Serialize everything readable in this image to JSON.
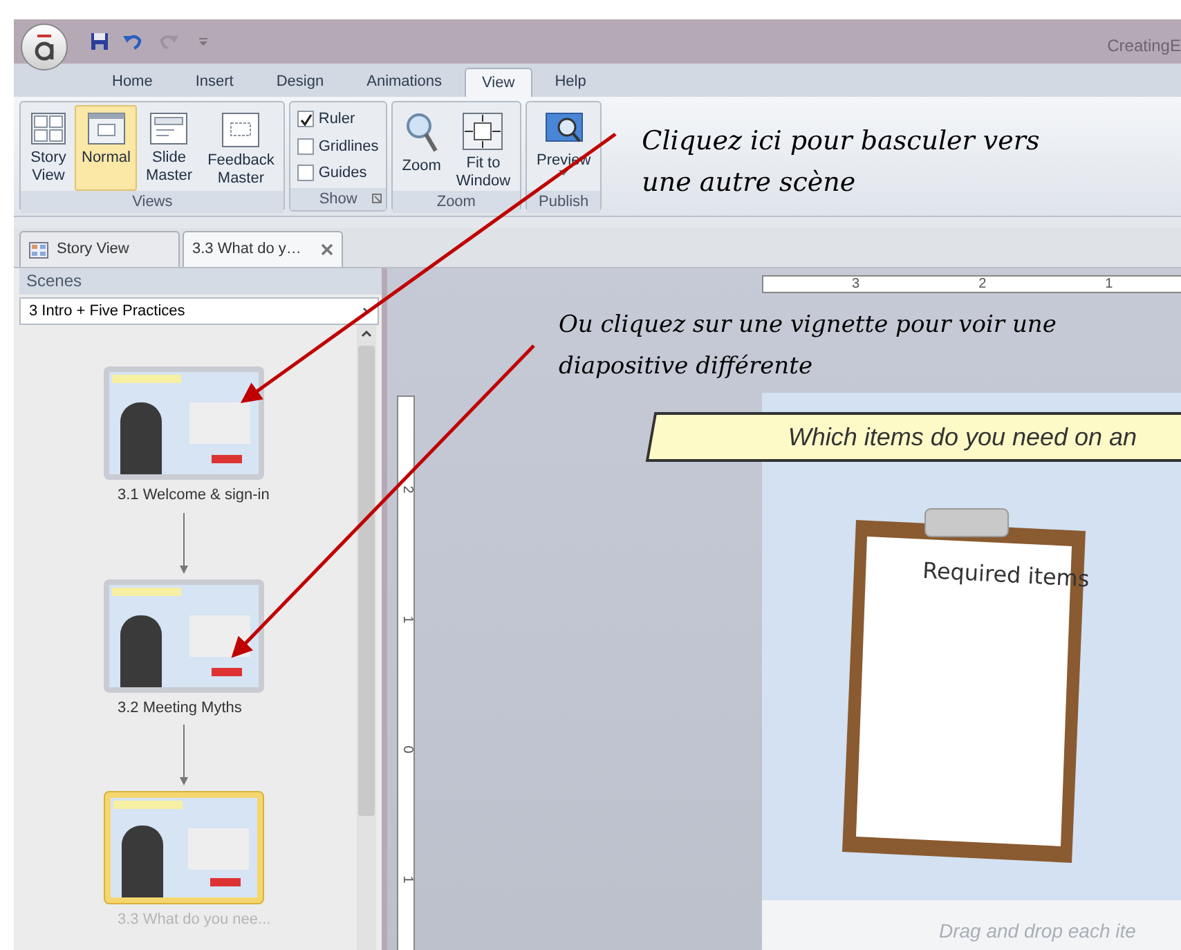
{
  "window": {
    "title": "CreatingE"
  },
  "ribbon_tabs": [
    {
      "label": "Home",
      "selected": false
    },
    {
      "label": "Insert",
      "selected": false
    },
    {
      "label": "Design",
      "selected": false
    },
    {
      "label": "Animations",
      "selected": false
    },
    {
      "label": "View",
      "selected": true
    },
    {
      "label": "Help",
      "selected": false
    }
  ],
  "ribbon_groups": [
    {
      "label": "Views",
      "kind": "buttons",
      "items": [
        {
          "label": "Story View",
          "selected": false
        },
        {
          "label": "Normal",
          "selected": true
        },
        {
          "label": "Slide Master",
          "selected": false
        },
        {
          "label": "Feedback Master",
          "selected": false
        }
      ]
    },
    {
      "label": "Show",
      "kind": "checkboxes",
      "launcher": true,
      "items": [
        {
          "label": "Ruler",
          "checked": true
        },
        {
          "label": "Gridlines",
          "checked": false
        },
        {
          "label": "Guides",
          "checked": false
        }
      ]
    },
    {
      "label": "Zoom",
      "kind": "buttons",
      "items": [
        {
          "label": "Zoom",
          "selected": false
        },
        {
          "label": "Fit to Window",
          "selected": false
        }
      ]
    },
    {
      "label": "Publish",
      "kind": "buttons",
      "items": [
        {
          "label": "Preview",
          "selected": false,
          "dropdown": true
        }
      ]
    }
  ],
  "annotations": [
    {
      "text": "Cliquez ici pour basculer vers une autre scène"
    },
    {
      "text": "Ou cliquez sur une vignette pour voir une diapositive différente"
    }
  ],
  "document_tabs": [
    {
      "label": "Story View",
      "selected": false,
      "closable": false
    },
    {
      "label": "3.3 What do y…",
      "selected": true,
      "closable": true
    }
  ],
  "scenes_panel": {
    "title": "Scenes",
    "dropdown": "3 Intro + Five Practices",
    "slides": [
      {
        "label": "3.1 Welcome & sign-in",
        "selected": false
      },
      {
        "label": "3.2 Meeting Myths",
        "selected": false
      },
      {
        "label": "3.3 What do you nee...",
        "selected": true
      }
    ]
  },
  "ruler": {
    "horizontal_marks": [
      "3",
      "2",
      "1"
    ],
    "vertical_marks": [
      "2",
      "1",
      "0",
      "1"
    ]
  },
  "slide": {
    "banner": "Which items do you need on an",
    "clipboard_label": "Required items",
    "instruction": "Drag and drop each ite"
  }
}
